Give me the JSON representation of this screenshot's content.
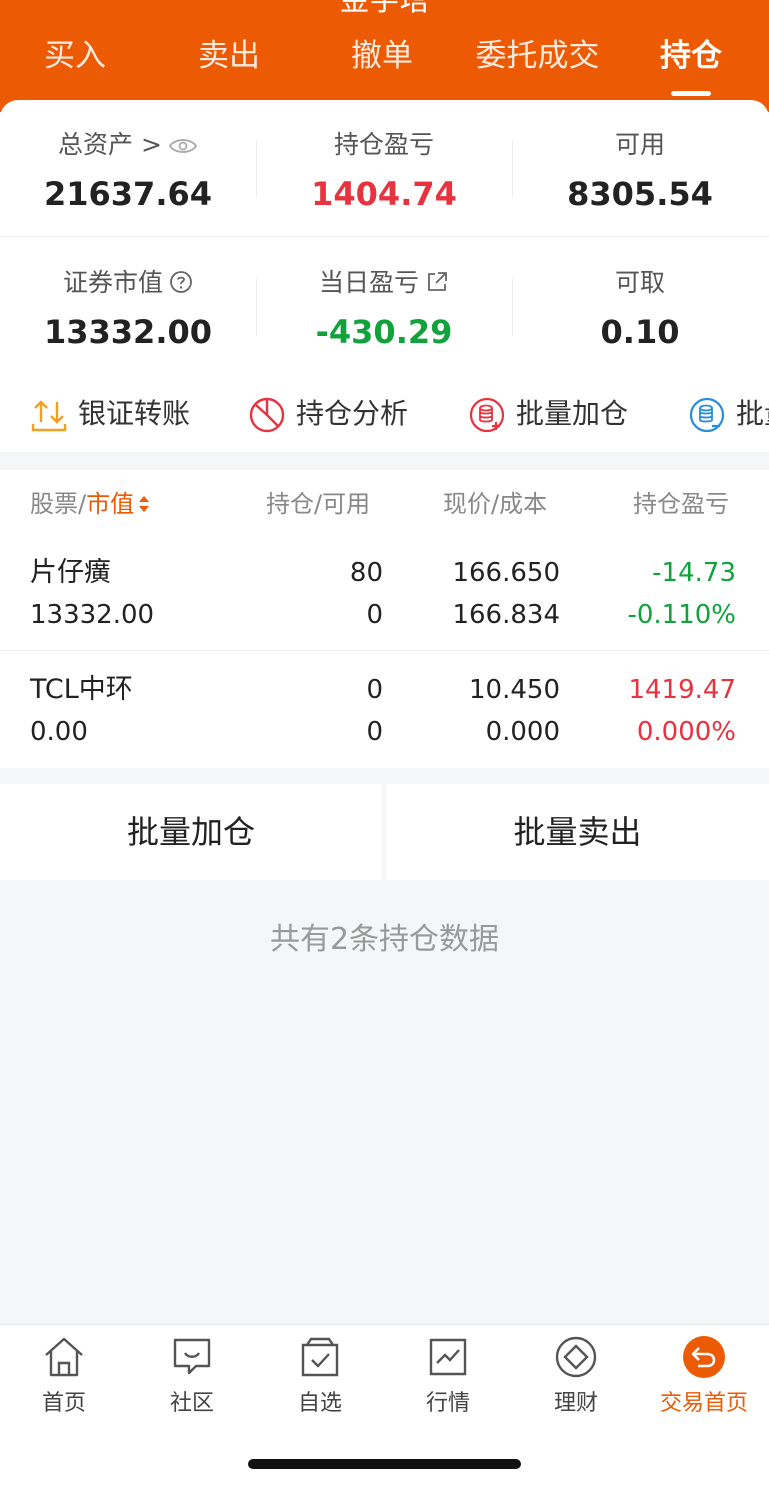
{
  "header": {
    "title": "金字塔",
    "tabs": [
      "买入",
      "卖出",
      "撤单",
      "委托成交",
      "持仓"
    ],
    "active_tab": "持仓"
  },
  "assets": {
    "total_label": "总资产 >",
    "total_value": "21637.64",
    "position_pl_label": "持仓盈亏",
    "position_pl_value": "1404.74",
    "available_label": "可用",
    "available_value": "8305.54",
    "market_value_label": "证券市值",
    "market_value_value": "13332.00",
    "daily_pl_label": "当日盈亏",
    "daily_pl_value": "-430.29",
    "withdrawable_label": "可取",
    "withdrawable_value": "0.10"
  },
  "actions": [
    "银证转账",
    "持仓分析",
    "批量加仓",
    "批量"
  ],
  "table": {
    "headers": {
      "stock": "股票",
      "slash": "/",
      "market_value": "市值",
      "position": "持仓/可用",
      "price": "现价/成本",
      "pl": "持仓盈亏"
    },
    "rows": [
      {
        "name": "片仔癀",
        "market_value": "13332.00",
        "position": "80",
        "available": "0",
        "price": "166.650",
        "cost": "166.834",
        "pl": "-14.73",
        "pl_pct": "-0.110%",
        "color": "#12a23c"
      },
      {
        "name": "TCL中环",
        "market_value": "0.00",
        "position": "0",
        "available": "0",
        "price": "10.450",
        "cost": "0.000",
        "pl": "1419.47",
        "pl_pct": "0.000%",
        "color": "#e8323e"
      }
    ]
  },
  "buttons": {
    "batch_add": "批量加仓",
    "batch_sell": "批量卖出"
  },
  "count_text": "共有2条持仓数据",
  "bottom_nav": [
    "首页",
    "社区",
    "自选",
    "行情",
    "理财",
    "交易首页"
  ],
  "colors": {
    "brand": "#ec5a04",
    "up": "#e8323e",
    "down": "#12a23c"
  }
}
